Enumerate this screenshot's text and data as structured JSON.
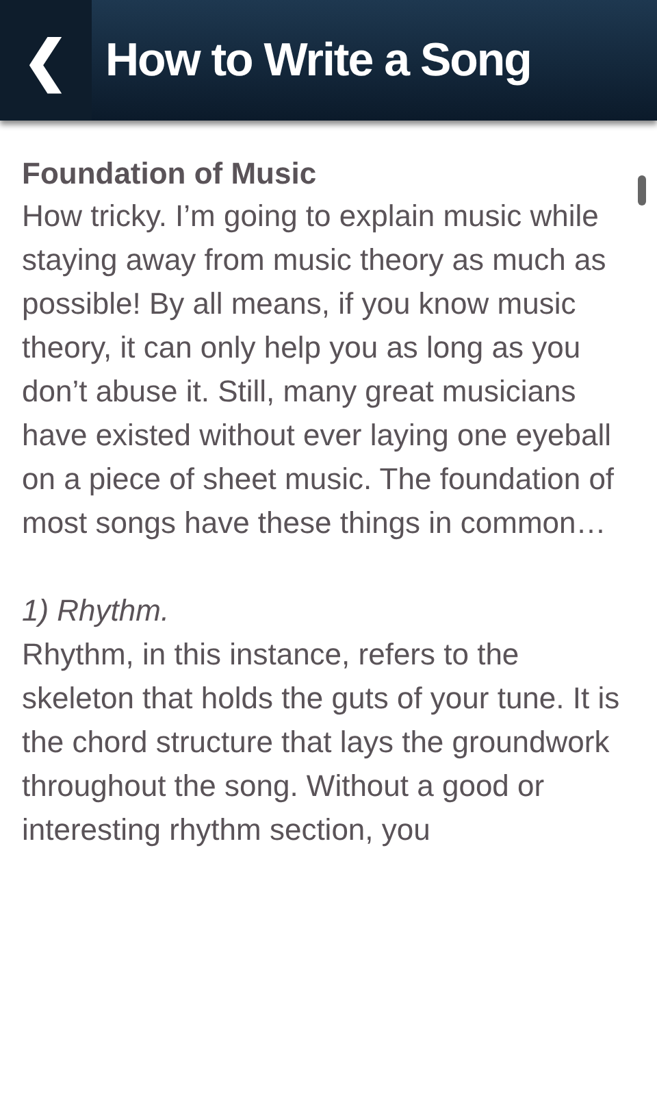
{
  "header": {
    "back_icon": "❮",
    "title": "How to Write a Song"
  },
  "article": {
    "heading": "Foundation of Music",
    "paragraphs": [
      {
        "kind": "body",
        "text": "How tricky. I’m going to explain music while staying away from music theory as much as possible! By all means, if you know music theory, it can only help you as long as you don’t abuse it. Still, many great musicians have existed without ever laying one eyeball on a piece of sheet music. The foundation of most songs have these things in common…"
      },
      {
        "kind": "subheading",
        "text": "1) Rhythm."
      },
      {
        "kind": "body",
        "text": "Rhythm, in this instance, refers to the skeleton that holds the guts of your tune. It is the chord structure that lays the groundwork throughout the song. Without a good or interesting rhythm section, you"
      }
    ]
  }
}
